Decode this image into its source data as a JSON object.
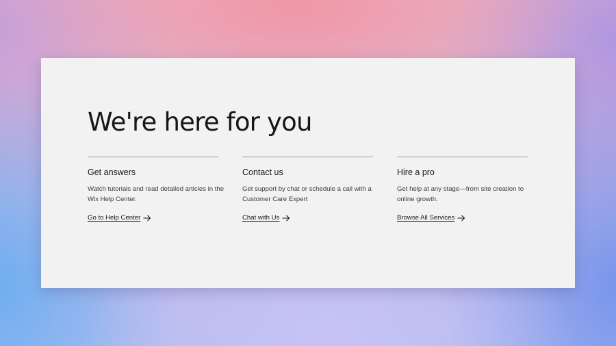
{
  "page": {
    "title": "We're here for you"
  },
  "columns": [
    {
      "heading": "Get answers",
      "description": "Watch tutorials and read detailed articles in the Wix Help Center.",
      "link_label": "Go to Help Center"
    },
    {
      "heading": "Contact us",
      "description": "Get support by chat or schedule a call with a Customer Care Expert",
      "link_label": "Chat with Us"
    },
    {
      "heading": "Hire a pro",
      "description": "Get help at any stage—from site creation to online growth.",
      "link_label": "Browse All Services"
    }
  ],
  "icons": {
    "link_arrow": "arrow-right-icon"
  },
  "colors": {
    "card_background": "#f2f2f2",
    "text": "#161616"
  }
}
